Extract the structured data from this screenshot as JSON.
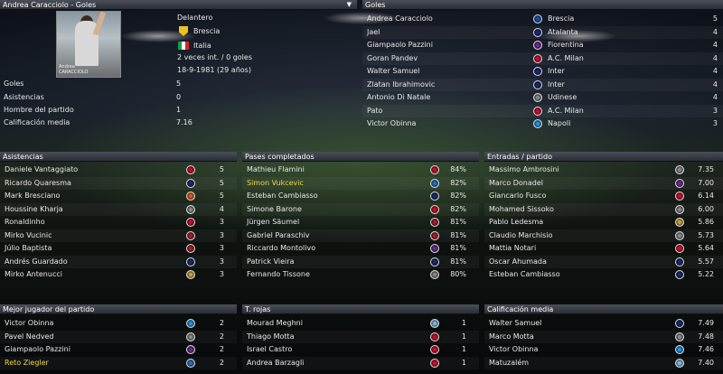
{
  "header": {
    "title": "Andrea Caracciolo - Goles",
    "dropdown": "▼"
  },
  "profile": {
    "position": "Delantero",
    "club": "Brescia",
    "nation": "Italia",
    "caps": "2 veces int. / 0 goles",
    "birth": "18-9-1981 (29 años)",
    "photo_caption_first": "Andrea",
    "photo_caption_last": "CARACCIOLO",
    "stats": [
      {
        "label": "Goles",
        "value": "5"
      },
      {
        "label": "Asistencias",
        "value": "0"
      },
      {
        "label": "Hombre del partido",
        "value": "1"
      },
      {
        "label": "Calificación media",
        "value": "7.16"
      }
    ]
  },
  "goles": {
    "title": "Goles",
    "rows": [
      {
        "name": "Andrea Caracciolo",
        "club": "Brescia",
        "value": "5",
        "color": "#1b4fa8"
      },
      {
        "name": "Jael",
        "club": "Atalanta",
        "value": "4",
        "color": "#1a2a80"
      },
      {
        "name": "Giampaolo Pazzini",
        "club": "Fiorentina",
        "value": "4",
        "color": "#6b2c91"
      },
      {
        "name": "Goran Pandev",
        "club": "A.C. Milan",
        "value": "4",
        "color": "#c8102e"
      },
      {
        "name": "Walter Samuel",
        "club": "Inter",
        "value": "4",
        "color": "#1a2a6c"
      },
      {
        "name": "Zlatan Ibrahimovic",
        "club": "Inter",
        "value": "4",
        "color": "#1a2a6c"
      },
      {
        "name": "Antonio Di Natale",
        "club": "Udinese",
        "value": "4",
        "color": "#888888"
      },
      {
        "name": "Pato",
        "club": "A.C. Milan",
        "value": "3",
        "color": "#c8102e"
      },
      {
        "name": "Victor Obinna",
        "club": "Napoli",
        "value": "3",
        "color": "#2a8fd8"
      }
    ]
  },
  "asistencias": {
    "title": "Asistencias",
    "rows": [
      {
        "name": "Daniele Vantaggiato",
        "value": "5",
        "color": "#c8102e",
        "highlight": false
      },
      {
        "name": "Ricardo Quaresma",
        "value": "5",
        "color": "#1a2a6c",
        "highlight": false
      },
      {
        "name": "Mark Bresciano",
        "value": "5",
        "color": "#e05a1a",
        "highlight": false
      },
      {
        "name": "Houssine Kharja",
        "value": "4",
        "color": "#888888",
        "highlight": false
      },
      {
        "name": "Ronaldinho",
        "value": "3",
        "color": "#c8102e",
        "highlight": false
      },
      {
        "name": "Mirko Vucinic",
        "value": "3",
        "color": "#a0202a",
        "highlight": false
      },
      {
        "name": "Júlio Baptista",
        "value": "3",
        "color": "#a0202a",
        "highlight": false
      },
      {
        "name": "Andrés Guardado",
        "value": "3",
        "color": "#1a2a6c",
        "highlight": false
      },
      {
        "name": "Mirko Antenucci",
        "value": "3",
        "color": "#c8a040",
        "highlight": false
      }
    ]
  },
  "pases": {
    "title": "Pases completados",
    "rows": [
      {
        "name": "Mathieu Flamini",
        "value": "84%",
        "color": "#c8102e",
        "highlight": false
      },
      {
        "name": "Simon Vukcevic",
        "value": "82%",
        "color": "#2a6fb8",
        "highlight": true
      },
      {
        "name": "Esteban Cambiasso",
        "value": "82%",
        "color": "#1a2a6c",
        "highlight": false
      },
      {
        "name": "Simone Barone",
        "value": "82%",
        "color": "#c8102e",
        "highlight": false
      },
      {
        "name": "Jürgen Säumel",
        "value": "81%",
        "color": "#a0202a",
        "highlight": false
      },
      {
        "name": "Gabriel Paraschiv",
        "value": "81%",
        "color": "#a0202a",
        "highlight": false
      },
      {
        "name": "Riccardo Montolivo",
        "value": "81%",
        "color": "#6b2c91",
        "highlight": false
      },
      {
        "name": "Patrick Vieira",
        "value": "81%",
        "color": "#1a2a6c",
        "highlight": false
      },
      {
        "name": "Fernando Tissone",
        "value": "80%",
        "color": "#888888",
        "highlight": false
      }
    ]
  },
  "entradas": {
    "title": "Entradas / partido",
    "rows": [
      {
        "name": "Massimo Ambrosini",
        "value": "7.35",
        "color": "#888888"
      },
      {
        "name": "Marco Donadel",
        "value": "7.00",
        "color": "#6b2c91"
      },
      {
        "name": "Giancarlo Fusco",
        "value": "6.14",
        "color": "#c8102e"
      },
      {
        "name": "Mohamed Sissoko",
        "value": "6.00",
        "color": "#888888"
      },
      {
        "name": "Pablo Ledesma",
        "value": "5.86",
        "color": "#c8a040"
      },
      {
        "name": "Claudio Marchisio",
        "value": "5.73",
        "color": "#888888"
      },
      {
        "name": "Mattia Notari",
        "value": "5.64",
        "color": "#c8102e"
      },
      {
        "name": "Oscar Ahumada",
        "value": "5.57",
        "color": "#1a2a6c"
      },
      {
        "name": "Esteban Cambiasso",
        "value": "5.22",
        "color": "#1a2a6c"
      }
    ]
  },
  "mejor": {
    "title": "Mejor jugador del partido",
    "rows": [
      {
        "name": "Victor Obinna",
        "value": "2",
        "color": "#2a8fd8",
        "highlight": false
      },
      {
        "name": "Pavel Nedved",
        "value": "2",
        "color": "#888888",
        "highlight": false
      },
      {
        "name": "Giampaolo Pazzini",
        "value": "2",
        "color": "#6b2c91",
        "highlight": false
      },
      {
        "name": "Reto Ziegler",
        "value": "2",
        "color": "#2a6fb8",
        "highlight": true
      }
    ]
  },
  "rojas": {
    "title": "T. rojas",
    "rows": [
      {
        "name": "Mourad Meghni",
        "value": "1",
        "color": "#7fb8e0"
      },
      {
        "name": "Thiago Motta",
        "value": "1",
        "color": "#c8102e"
      },
      {
        "name": "Israel Castro",
        "value": "1",
        "color": "#c8102e"
      },
      {
        "name": "Andrea Barzagli",
        "value": "1",
        "color": "#c8102e"
      }
    ]
  },
  "calificacion": {
    "title": "Calificación media",
    "rows": [
      {
        "name": "Walter Samuel",
        "value": "7.49",
        "color": "#1a2a6c"
      },
      {
        "name": "Marco Motta",
        "value": "7.48",
        "color": "#888888"
      },
      {
        "name": "Victor Obinna",
        "value": "7.46",
        "color": "#2a8fd8"
      },
      {
        "name": "Matuzalém",
        "value": "7.40",
        "color": "#7fb8e0"
      }
    ]
  }
}
